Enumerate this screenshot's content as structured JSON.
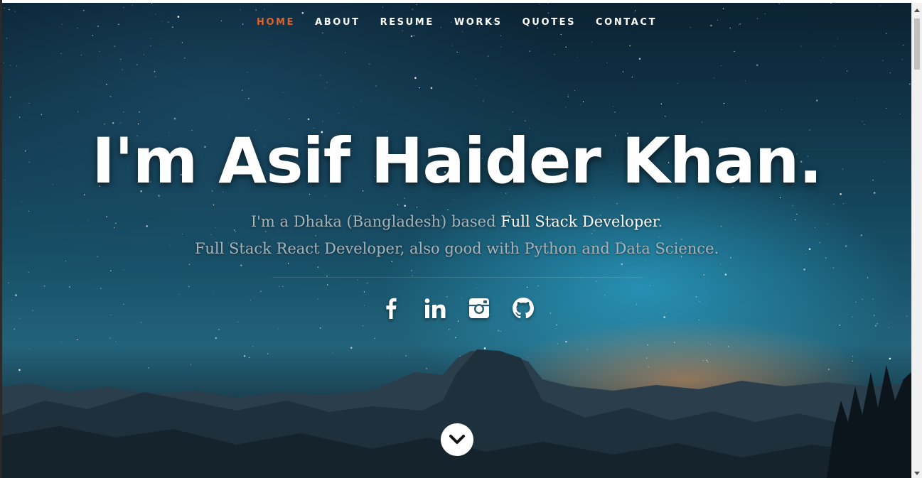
{
  "nav": {
    "items": [
      {
        "label": "HOME",
        "active": true
      },
      {
        "label": "ABOUT",
        "active": false
      },
      {
        "label": "RESUME",
        "active": false
      },
      {
        "label": "WORKS",
        "active": false
      },
      {
        "label": "QUOTES",
        "active": false
      },
      {
        "label": "CONTACT",
        "active": false
      }
    ],
    "active_color": "#e0632b"
  },
  "hero": {
    "headline": "I'm Asif Haider Khan.",
    "line1_prefix": "I'm a Dhaka (Bangladesh) based ",
    "line1_highlight": "Full Stack Developer",
    "line1_suffix": ".",
    "line2": "Full Stack React Developer, also good with Python and Data Science."
  },
  "social": [
    {
      "icon": "facebook-icon"
    },
    {
      "icon": "linkedin-icon"
    },
    {
      "icon": "instagram-icon"
    },
    {
      "icon": "github-icon"
    }
  ],
  "scroll_down": {
    "icon": "chevron-down-icon"
  }
}
